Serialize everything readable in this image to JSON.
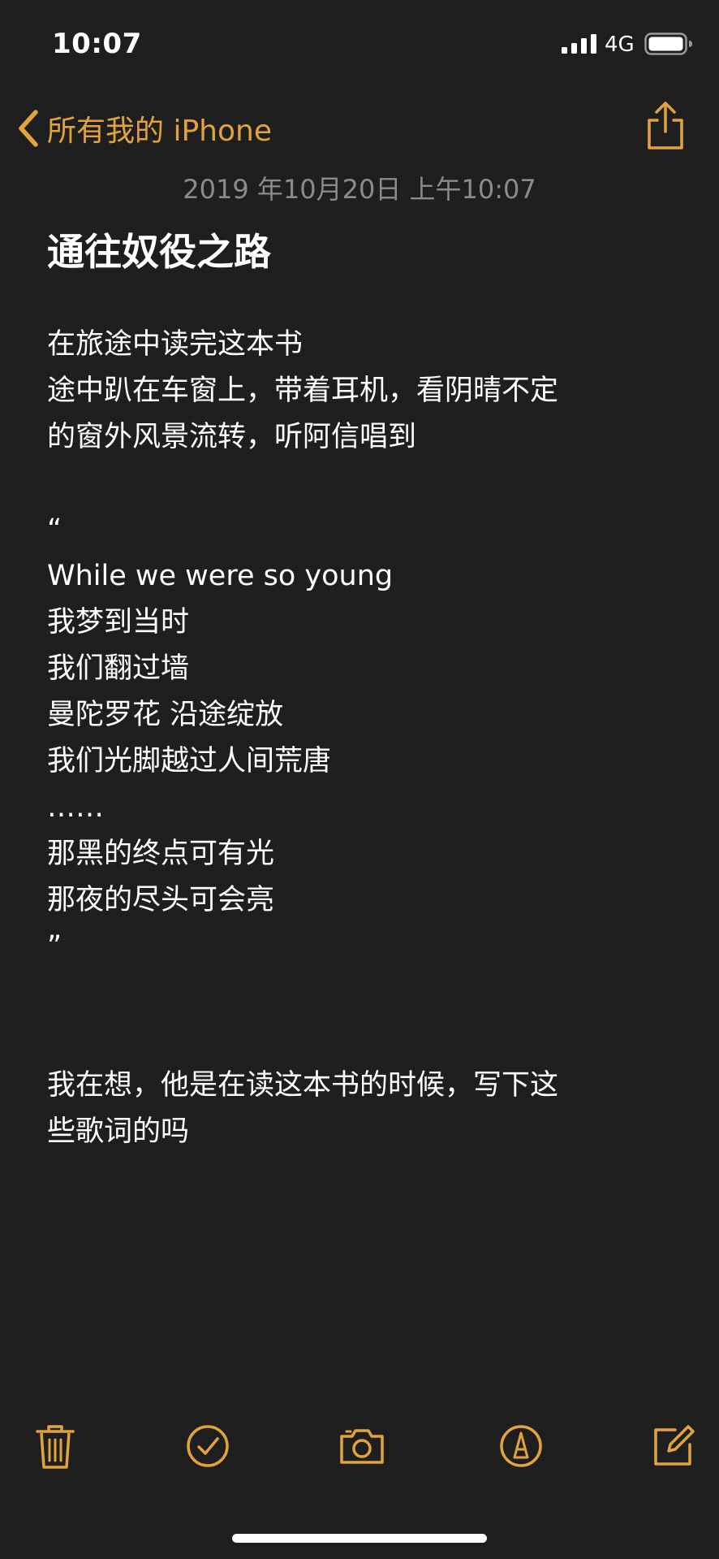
{
  "status_bar": {
    "time": "10:07",
    "network": "4G",
    "icons": [
      "signal-bars-icon",
      "battery-icon"
    ]
  },
  "nav": {
    "back_label": "所有我的 iPhone",
    "back_icon": "chevron-left-icon",
    "share_icon": "share-icon",
    "accent_color": "#e2a43a"
  },
  "note": {
    "date": "2019 年10月20日 上午10:07",
    "title": "通往奴役之路",
    "lines": [
      "在旅途中读完这本书",
      "途中趴在车窗上，带着耳机，看阴晴不定",
      "的窗外风景流转，听阿信唱到",
      "",
      "“",
      "While we were so young",
      "我梦到当时",
      "我们翻过墙",
      "曼陀罗花 沿途绽放",
      "我们光脚越过人间荒唐",
      "……",
      "那黑的终点可有光",
      "那夜的尽头可会亮",
      "”",
      "",
      "",
      "我在想，他是在读这本书的时候，写下这",
      "些歌词的吗"
    ]
  },
  "toolbar": {
    "icons": [
      "trash-icon",
      "checklist-icon",
      "camera-icon",
      "markup-icon",
      "compose-icon"
    ]
  },
  "colors": {
    "background": "#1e1e1e",
    "text": "#ffffff",
    "date_text": "#8b8b8b",
    "accent": "#e2a43a"
  }
}
